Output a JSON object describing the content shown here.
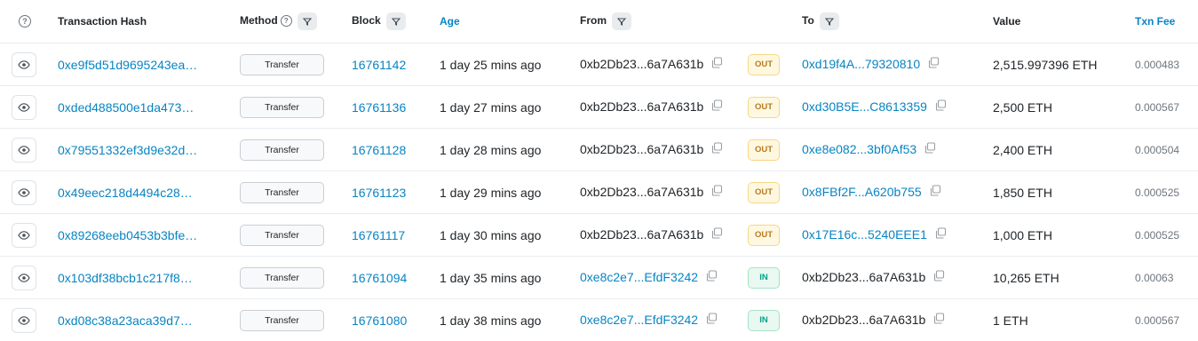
{
  "header": {
    "txn_hash": "Transaction Hash",
    "method": "Method",
    "block": "Block",
    "age": "Age",
    "from": "From",
    "to": "To",
    "value": "Value",
    "txn_fee": "Txn Fee"
  },
  "rows": [
    {
      "hash": "0xe9f5d51d9695243ea…",
      "method": "Transfer",
      "block": "16761142",
      "age": "1 day 25 mins ago",
      "from": "0xb2Db23...6a7A631b",
      "from_link": false,
      "dir": "OUT",
      "to": "0xd19f4A...79320810",
      "to_link": true,
      "value": "2,515.997396 ETH",
      "fee": "0.000483"
    },
    {
      "hash": "0xded488500e1da473…",
      "method": "Transfer",
      "block": "16761136",
      "age": "1 day 27 mins ago",
      "from": "0xb2Db23...6a7A631b",
      "from_link": false,
      "dir": "OUT",
      "to": "0xd30B5E...C8613359",
      "to_link": true,
      "value": "2,500 ETH",
      "fee": "0.000567"
    },
    {
      "hash": "0x79551332ef3d9e32d…",
      "method": "Transfer",
      "block": "16761128",
      "age": "1 day 28 mins ago",
      "from": "0xb2Db23...6a7A631b",
      "from_link": false,
      "dir": "OUT",
      "to": "0xe8e082...3bf0Af53",
      "to_link": true,
      "value": "2,400 ETH",
      "fee": "0.000504"
    },
    {
      "hash": "0x49eec218d4494c28…",
      "method": "Transfer",
      "block": "16761123",
      "age": "1 day 29 mins ago",
      "from": "0xb2Db23...6a7A631b",
      "from_link": false,
      "dir": "OUT",
      "to": "0x8FBf2F...A620b755",
      "to_link": true,
      "value": "1,850 ETH",
      "fee": "0.000525"
    },
    {
      "hash": "0x89268eeb0453b3bfe…",
      "method": "Transfer",
      "block": "16761117",
      "age": "1 day 30 mins ago",
      "from": "0xb2Db23...6a7A631b",
      "from_link": false,
      "dir": "OUT",
      "to": "0x17E16c...5240EEE1",
      "to_link": true,
      "value": "1,000 ETH",
      "fee": "0.000525"
    },
    {
      "hash": "0x103df38bcb1c217f8…",
      "method": "Transfer",
      "block": "16761094",
      "age": "1 day 35 mins ago",
      "from": "0xe8c2e7...EfdF3242",
      "from_link": true,
      "dir": "IN",
      "to": "0xb2Db23...6a7A631b",
      "to_link": false,
      "value": "10,265 ETH",
      "fee": "0.00063"
    },
    {
      "hash": "0xd08c38a23aca39d7…",
      "method": "Transfer",
      "block": "16761080",
      "age": "1 day 38 mins ago",
      "from": "0xe8c2e7...EfdF3242",
      "from_link": true,
      "dir": "IN",
      "to": "0xb2Db23...6a7A631b",
      "to_link": false,
      "value": "1 ETH",
      "fee": "0.000567"
    }
  ]
}
